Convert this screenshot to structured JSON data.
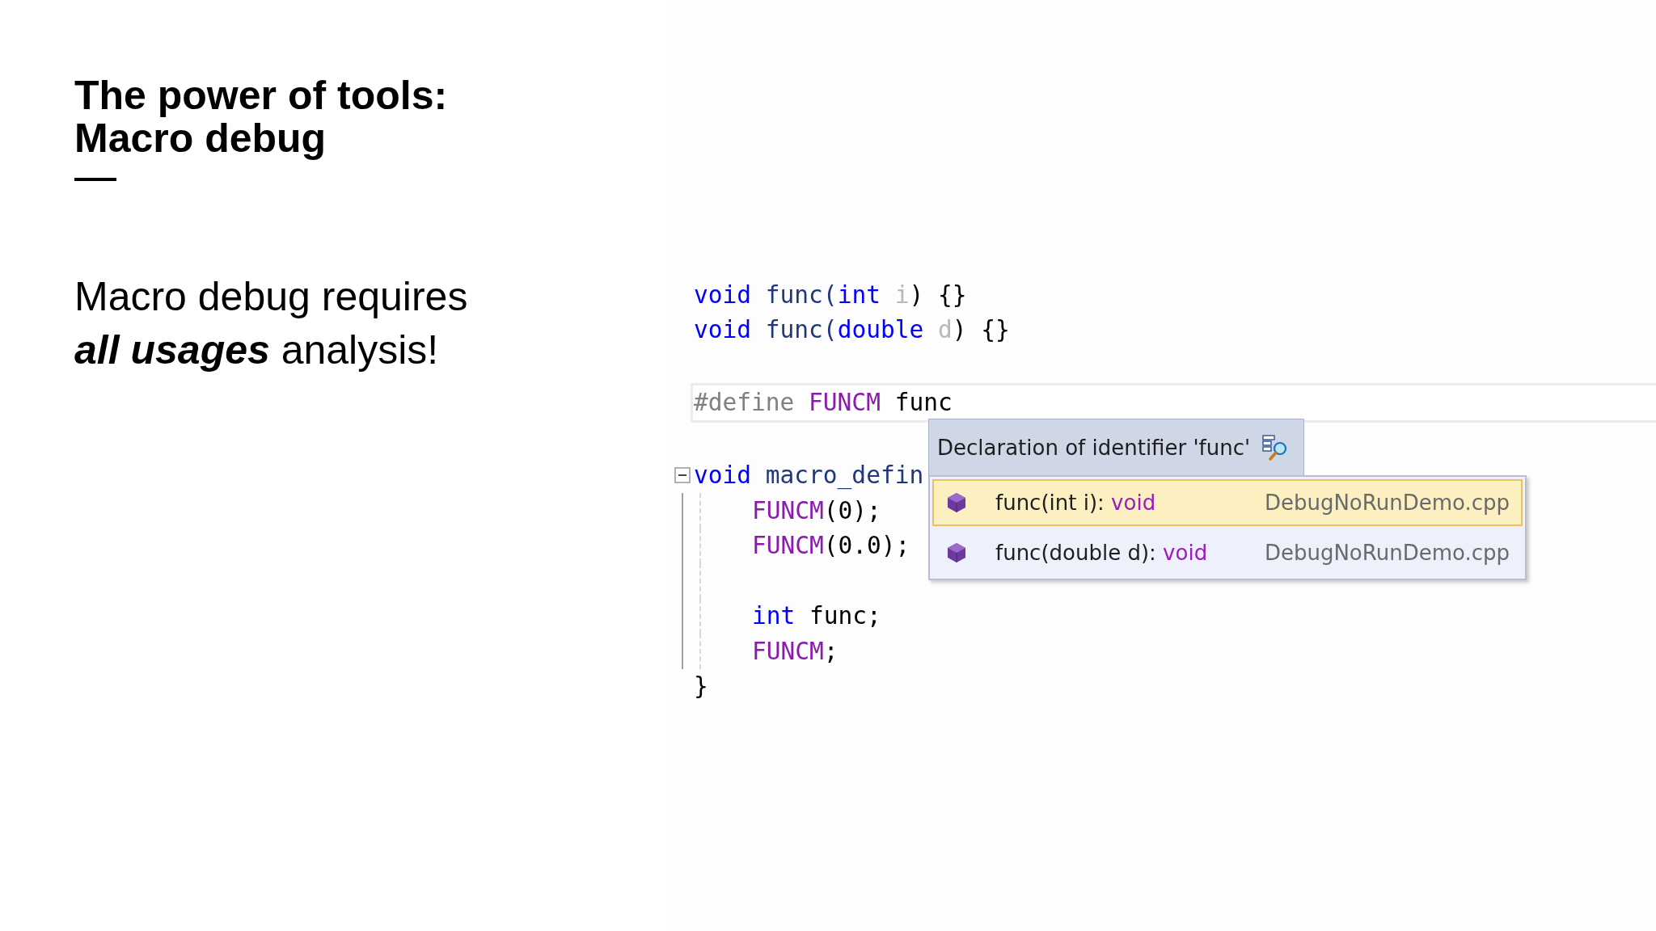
{
  "slide": {
    "title_lines": [
      "The power of tools:",
      "Macro debug"
    ],
    "body_lines": [
      "Macro debug requires",
      "**all usages** analysis!"
    ]
  },
  "editor": {
    "lines": [
      {
        "kind": "code",
        "tokens": [
          {
            "text": "void",
            "kind": "keyword"
          },
          {
            "text": " func(",
            "kind": "ident"
          },
          {
            "text": "int",
            "kind": "keyword"
          },
          {
            "text": " i",
            "kind": "unused"
          },
          {
            "text": ") {}",
            "kind": "plain"
          }
        ]
      },
      {
        "kind": "code",
        "tokens": [
          {
            "text": "void",
            "kind": "keyword"
          },
          {
            "text": " func(",
            "kind": "ident"
          },
          {
            "text": "double",
            "kind": "keyword"
          },
          {
            "text": " d",
            "kind": "unused"
          },
          {
            "text": ") {}",
            "kind": "plain"
          }
        ]
      },
      {
        "kind": "blank"
      },
      {
        "kind": "code",
        "highlighted": true,
        "tokens": [
          {
            "text": "#define",
            "kind": "directive"
          },
          {
            "text": " FUNCM",
            "kind": "macro"
          },
          {
            "text": " func",
            "kind": "plain"
          }
        ]
      },
      {
        "kind": "blank"
      },
      {
        "kind": "code",
        "expanded": true,
        "tokens": [
          {
            "text": "void",
            "kind": "keyword"
          },
          {
            "text": " macro_defin",
            "kind": "ident"
          }
        ],
        "children": [
          {
            "kind": "code",
            "tokens": [
              {
                "text": "FUNCM",
                "kind": "macro"
              },
              {
                "text": "(0);",
                "kind": "plain"
              }
            ]
          },
          {
            "kind": "code",
            "tokens": [
              {
                "text": "FUNCM",
                "kind": "macro"
              },
              {
                "text": "(0.0);",
                "kind": "plain"
              }
            ]
          },
          {
            "kind": "blank"
          },
          {
            "kind": "code",
            "tokens": [
              {
                "text": "int",
                "kind": "keyword"
              },
              {
                "text": " func;",
                "kind": "plain"
              }
            ]
          },
          {
            "kind": "code",
            "tokens": [
              {
                "text": "FUNCM",
                "kind": "macro"
              },
              {
                "text": ";",
                "kind": "plain"
              }
            ]
          }
        ]
      },
      {
        "kind": "code",
        "tokens": [
          {
            "text": "}",
            "kind": "plain"
          }
        ]
      }
    ]
  },
  "popup": {
    "header": "Declaration of identifier 'func'",
    "items": [
      {
        "signature": "func(int i): ",
        "return_type": "void",
        "file": "DebugNoRunDemo.cpp",
        "selected": true
      },
      {
        "signature": "func(double d): ",
        "return_type": "void",
        "file": "DebugNoRunDemo.cpp",
        "selected": false
      }
    ]
  }
}
